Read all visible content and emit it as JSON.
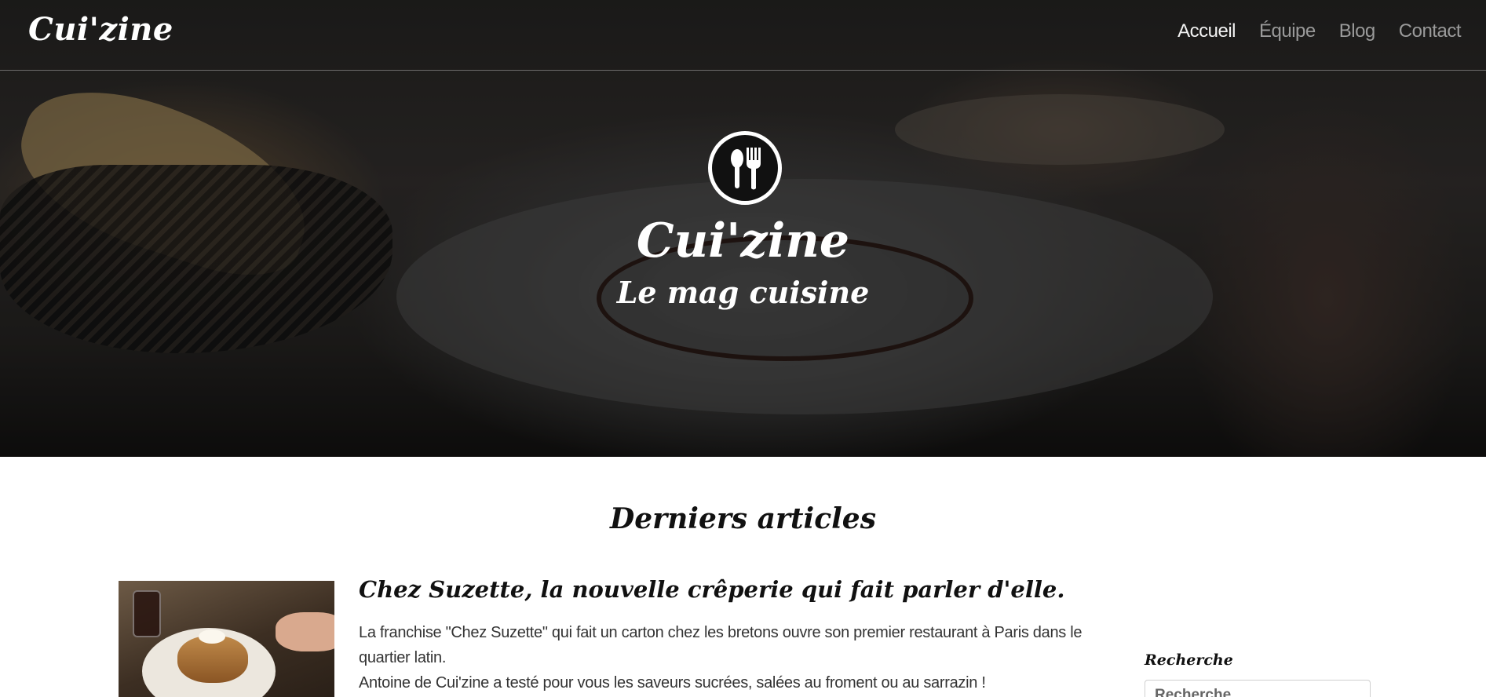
{
  "header": {
    "brand": "Cui'zine",
    "nav": [
      {
        "label": "Accueil",
        "active": true
      },
      {
        "label": "Équipe",
        "active": false
      },
      {
        "label": "Blog",
        "active": false
      },
      {
        "label": "Contact",
        "active": false
      }
    ]
  },
  "hero": {
    "logo_icon": "spoon-fork-icon",
    "title": "Cui'zine",
    "subtitle": "Le mag cuisine"
  },
  "main": {
    "section_title": "Derniers articles",
    "articles": [
      {
        "title": "Chez Suzette, la nouvelle crêperie qui fait parler d'elle.",
        "excerpt_line1": "La franchise \"Chez Suzette\" qui fait un carton chez les bretons ouvre son premier restaurant à Paris dans le quartier latin.",
        "excerpt_line2": "Antoine de Cui'zine a testé pour vous les saveurs sucrées, salées au froment ou au sarrazin !"
      }
    ]
  },
  "sidebar": {
    "search_label": "Recherche",
    "search_placeholder": "Recherche"
  },
  "colors": {
    "nav_active": "#f2f2f2",
    "nav_inactive": "#9a9a9a",
    "text_dark": "#111111"
  }
}
